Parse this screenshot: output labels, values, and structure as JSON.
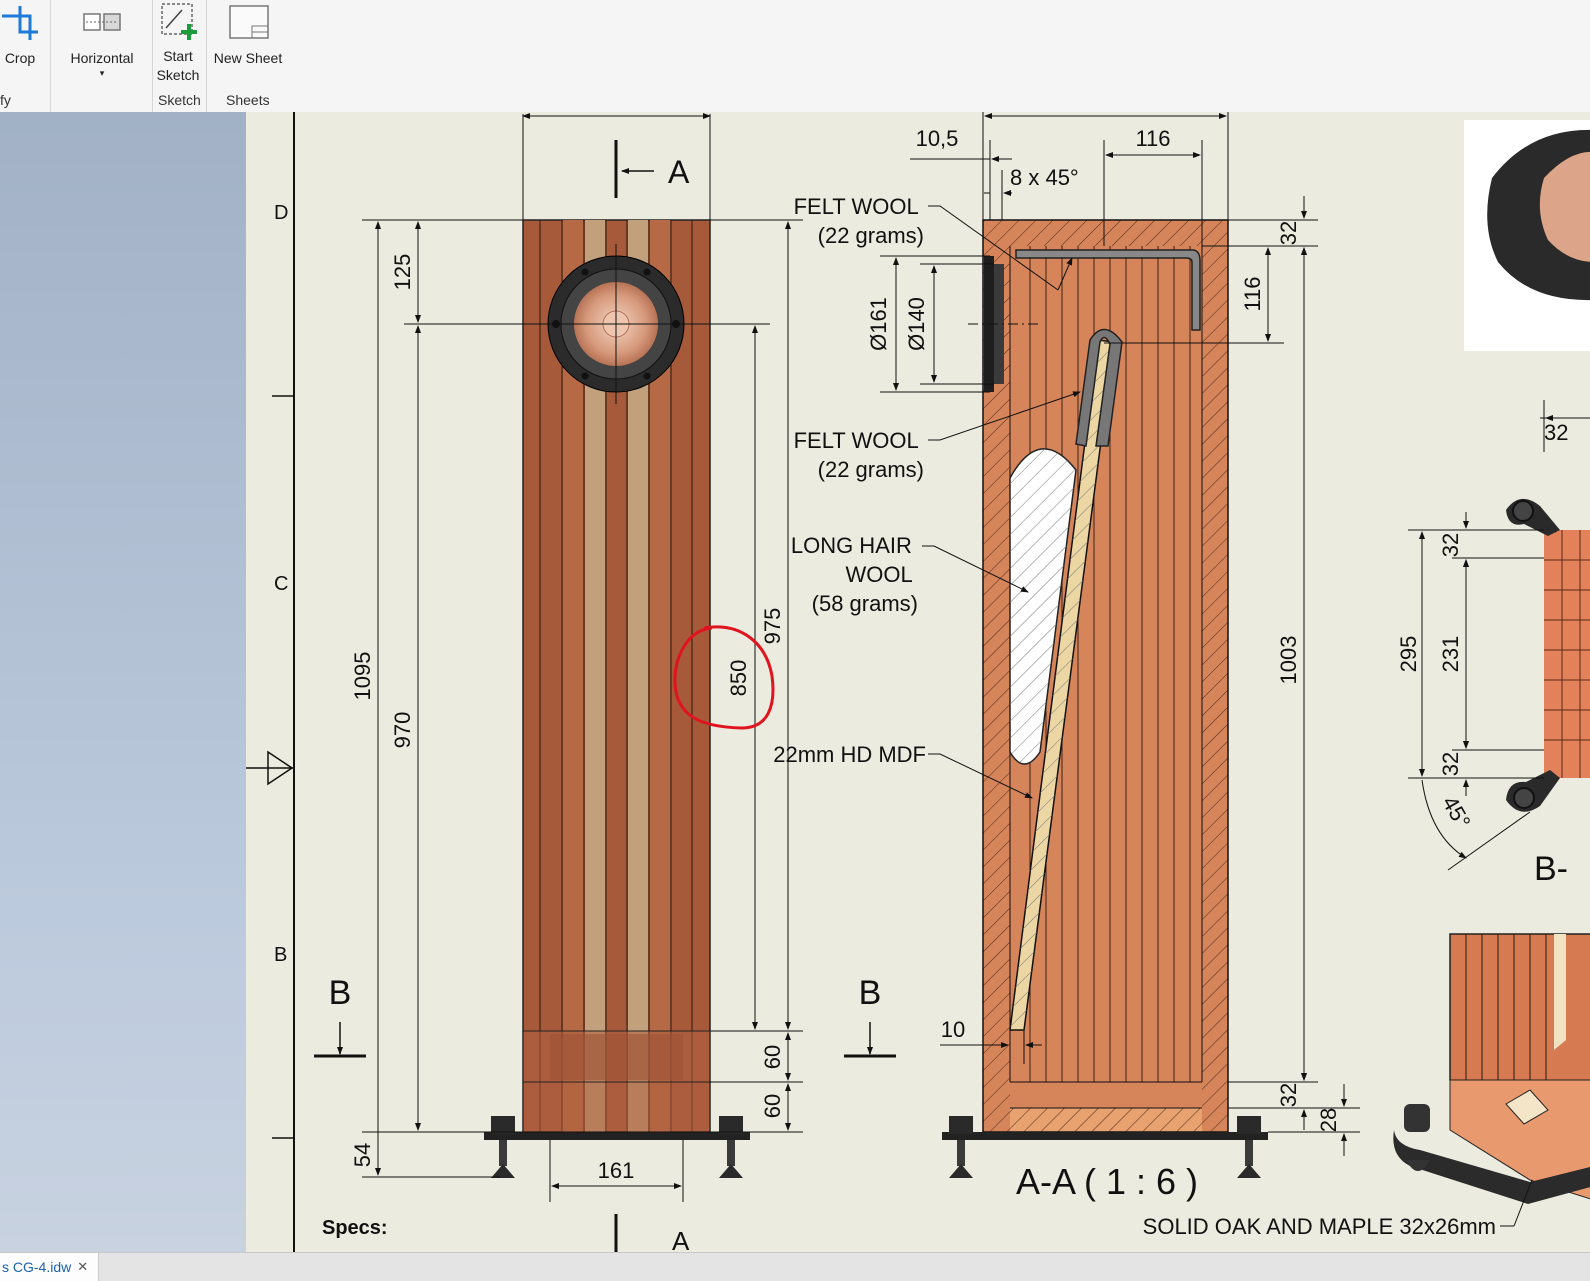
{
  "ribbon": {
    "crop_label": "Crop",
    "horizontal_label": "Horizontal",
    "start_sketch_line1": "Start",
    "start_sketch_line2": "Sketch",
    "new_sheet_label": "New Sheet",
    "group_modify": "fy",
    "group_sketch": "Sketch",
    "group_sheets": "Sheets"
  },
  "tab": {
    "file_name": "s CG-4.idw"
  },
  "drawing": {
    "zone_labels": [
      "D",
      "C",
      "B"
    ],
    "section_a_label": "A",
    "section_b_label": "B",
    "specs_label": "Specs:",
    "felt_wool_1": [
      "FELT WOOL",
      "(22 grams)"
    ],
    "felt_wool_2": [
      "FELT WOOL",
      "(22 grams)"
    ],
    "long_hair_wool": [
      "LONG HAIR",
      "WOOL",
      "(58 grams)"
    ],
    "mdf_label": "22mm HD MDF",
    "section_title": "A-A ( 1 : 6 )",
    "solid_label": "SOLID OAK AND MAPLE 32x26mm",
    "b_view_label": "B-",
    "front_dims": {
      "d125": "125",
      "d1095": "1095",
      "d970": "970",
      "d975": "975",
      "d850": "850",
      "d60a": "60",
      "d60b": "60",
      "d54": "54",
      "d161": "161"
    },
    "section_dims": {
      "d10_5": "10,5",
      "d116_top": "116",
      "chamfer": "8 x 45°",
      "d32_top": "32",
      "d116_side": "116",
      "dia161": "Ø161",
      "dia140": "Ø140",
      "d1003": "1003",
      "d32_bot": "32",
      "d28": "28",
      "d10": "10"
    },
    "b_dims": {
      "d32_top": "32",
      "d32_a": "32",
      "d295": "295",
      "d231": "231",
      "d32_b": "32",
      "angle": "45°"
    }
  },
  "colors": {
    "wood_dark": "#a65a3a",
    "wood_light": "#c2a07c",
    "section_wood": "#d6845a",
    "annotation_red": "#e0141e",
    "sheet_bg": "#ecebdf"
  }
}
